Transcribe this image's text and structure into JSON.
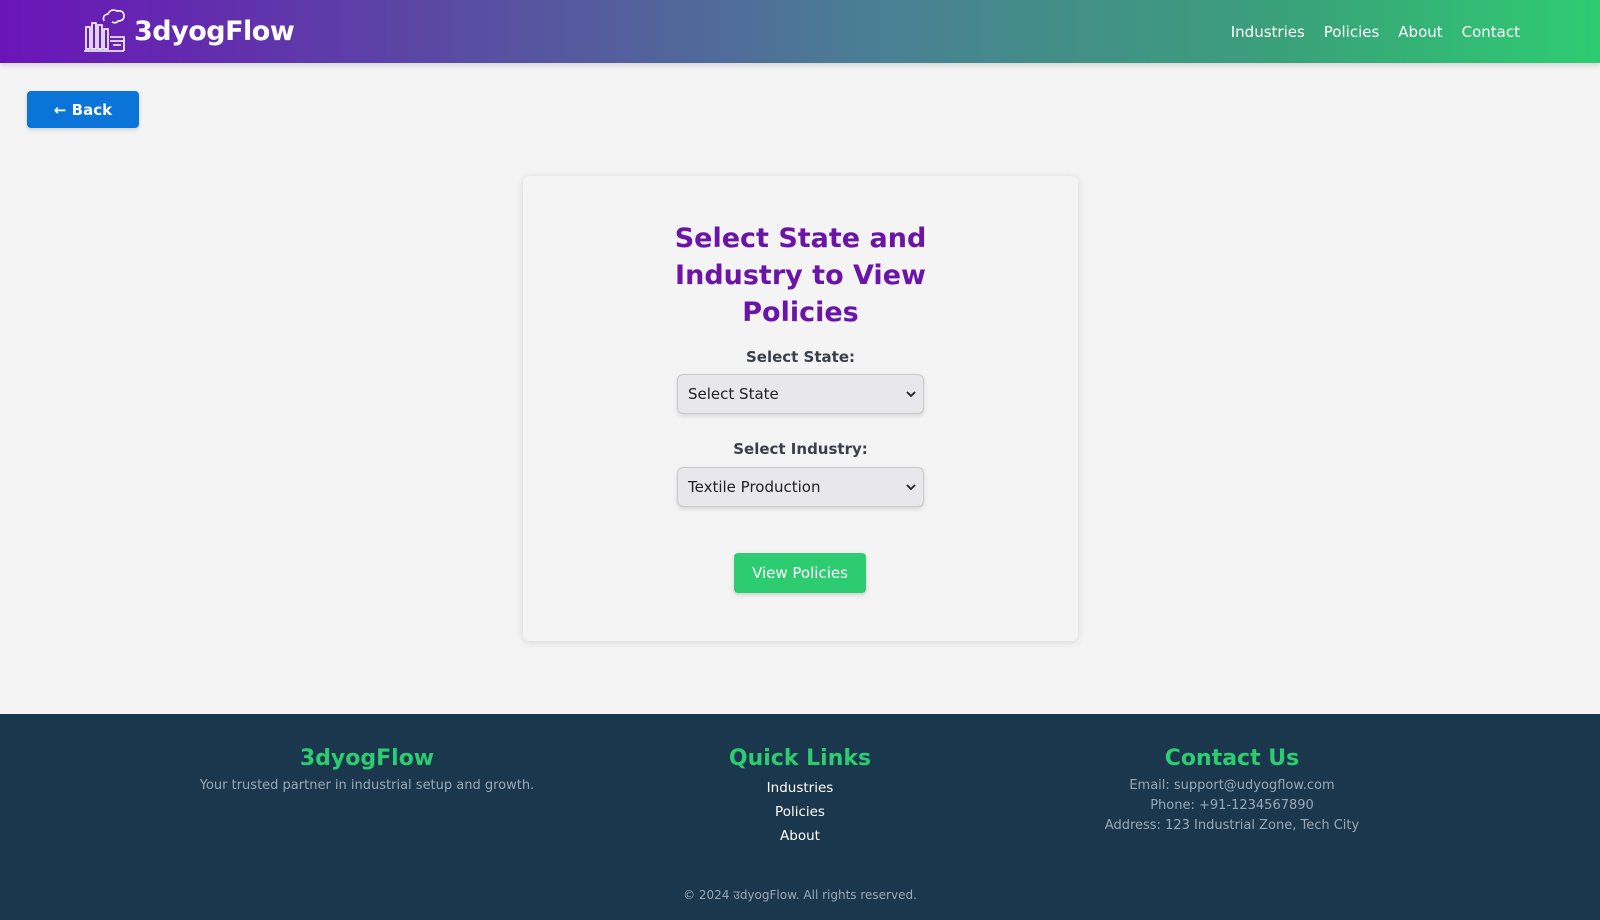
{
  "header": {
    "brand_name": "3dyogFlow",
    "nav": [
      "Industries",
      "Policies",
      "About",
      "Contact"
    ]
  },
  "back_button": "← Back",
  "form": {
    "title": "Select State and Industry to View Policies",
    "state_label": "Select State:",
    "state_value": "Select State",
    "industry_label": "Select Industry:",
    "industry_value": "Textile Production",
    "submit_label": "View Policies"
  },
  "footer": {
    "brand": {
      "title": "3dyogFlow",
      "tagline": "Your trusted partner in industrial setup and growth."
    },
    "quick_links": {
      "title": "Quick Links",
      "items": [
        "Industries",
        "Policies",
        "About"
      ]
    },
    "contact": {
      "title": "Contact Us",
      "email": "Email: support@udyogflow.com",
      "phone": "Phone: +91-1234567890",
      "address": "Address: 123 Industrial Zone, Tech City"
    },
    "copyright": "© 2024 उdyogFlow. All rights reserved."
  },
  "colors": {
    "accent_purple": "#6a14a8",
    "accent_green": "#2ecc71",
    "back_blue": "#0b74d9",
    "footer_bg": "#1b374d"
  }
}
